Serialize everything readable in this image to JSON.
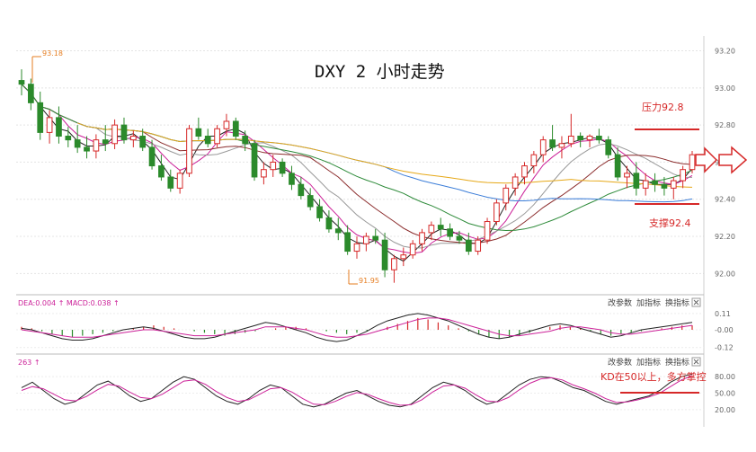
{
  "chart_data": [
    {
      "type": "candlestick",
      "title": "DXY 2 小时走势",
      "y_axis_ticks": [
        "93.20",
        "93.00",
        "92.80",
        "92.60",
        "92.40",
        "92.20",
        "92.00"
      ],
      "ylim": [
        91.9,
        93.28
      ],
      "grid": true,
      "extremes": {
        "high": "93.18",
        "low": "91.95"
      },
      "annotations": {
        "resistance_label": "压力92.8",
        "resistance_level": 92.8,
        "support_label": "支撑92.4",
        "support_level": 92.4,
        "kd_note": "KD在50以上，多方掌控"
      },
      "series": [
        {
          "values": [
            [
              93.04,
              93.1,
              92.96,
              93.02
            ],
            [
              93.02,
              93.05,
              92.88,
              92.92
            ],
            [
              92.92,
              92.98,
              92.72,
              92.76
            ],
            [
              92.76,
              92.88,
              92.7,
              92.84
            ],
            [
              92.84,
              92.9,
              92.7,
              92.74
            ],
            [
              92.74,
              92.79,
              92.68,
              92.72
            ],
            [
              92.72,
              92.8,
              92.65,
              92.68
            ],
            [
              92.68,
              92.74,
              92.62,
              92.66
            ],
            [
              92.66,
              92.75,
              92.62,
              92.72
            ],
            [
              92.72,
              92.8,
              92.66,
              92.7
            ],
            [
              92.7,
              92.83,
              92.67,
              92.8
            ],
            [
              92.8,
              92.84,
              92.7,
              92.72
            ],
            [
              92.72,
              92.77,
              92.68,
              92.74
            ],
            [
              92.74,
              92.78,
              92.66,
              92.68
            ],
            [
              92.68,
              92.72,
              92.56,
              92.58
            ],
            [
              92.58,
              92.64,
              92.5,
              92.52
            ],
            [
              92.52,
              92.56,
              92.44,
              92.46
            ],
            [
              92.46,
              92.56,
              92.43,
              92.54
            ],
            [
              92.54,
              92.8,
              92.52,
              92.78
            ],
            [
              92.78,
              92.84,
              92.72,
              92.74
            ],
            [
              92.74,
              92.78,
              92.68,
              92.7
            ],
            [
              92.7,
              92.8,
              92.68,
              92.78
            ],
            [
              92.78,
              92.86,
              92.74,
              92.82
            ],
            [
              92.82,
              92.84,
              92.72,
              92.74
            ],
            [
              92.74,
              92.77,
              92.66,
              92.7
            ],
            [
              92.7,
              92.72,
              92.5,
              92.52
            ],
            [
              92.52,
              92.6,
              92.48,
              92.56
            ],
            [
              92.56,
              92.64,
              92.52,
              92.6
            ],
            [
              92.6,
              92.62,
              92.52,
              92.54
            ],
            [
              92.54,
              92.58,
              92.45,
              92.48
            ],
            [
              92.48,
              92.52,
              92.4,
              92.42
            ],
            [
              92.42,
              92.46,
              92.34,
              92.36
            ],
            [
              92.36,
              92.4,
              92.28,
              92.3
            ],
            [
              92.3,
              92.34,
              92.22,
              92.24
            ],
            [
              92.24,
              92.3,
              92.18,
              92.22
            ],
            [
              92.22,
              92.26,
              92.1,
              92.12
            ],
            [
              92.12,
              92.2,
              92.08,
              92.16
            ],
            [
              92.16,
              92.22,
              92.12,
              92.2
            ],
            [
              92.2,
              92.24,
              92.16,
              92.18
            ],
            [
              92.18,
              92.22,
              91.98,
              92.02
            ],
            [
              92.02,
              92.1,
              91.95,
              92.08
            ],
            [
              92.08,
              92.14,
              92.04,
              92.1
            ],
            [
              92.1,
              92.18,
              92.08,
              92.16
            ],
            [
              92.16,
              92.24,
              92.12,
              92.22
            ],
            [
              92.22,
              92.28,
              92.18,
              92.26
            ],
            [
              92.26,
              92.3,
              92.2,
              92.24
            ],
            [
              92.24,
              92.27,
              92.18,
              92.2
            ],
            [
              92.2,
              92.23,
              92.16,
              92.18
            ],
            [
              92.18,
              92.22,
              92.1,
              92.12
            ],
            [
              92.12,
              92.2,
              92.1,
              92.18
            ],
            [
              92.18,
              92.3,
              92.16,
              92.28
            ],
            [
              92.28,
              92.4,
              92.26,
              92.38
            ],
            [
              92.38,
              92.48,
              92.34,
              92.46
            ],
            [
              92.46,
              92.54,
              92.42,
              92.52
            ],
            [
              92.52,
              92.6,
              92.48,
              92.58
            ],
            [
              92.58,
              92.66,
              92.54,
              92.64
            ],
            [
              92.64,
              92.74,
              92.6,
              92.72
            ],
            [
              92.72,
              92.8,
              92.66,
              92.68
            ],
            [
              92.68,
              92.74,
              92.62,
              92.7
            ],
            [
              92.7,
              92.86,
              92.68,
              92.74
            ],
            [
              92.74,
              92.76,
              92.68,
              92.72
            ],
            [
              92.72,
              92.75,
              92.68,
              92.74
            ],
            [
              92.74,
              92.78,
              92.7,
              92.72
            ],
            [
              92.72,
              92.74,
              92.62,
              92.64
            ],
            [
              92.64,
              92.68,
              92.5,
              92.52
            ],
            [
              92.52,
              92.58,
              92.46,
              92.54
            ],
            [
              92.54,
              92.6,
              92.42,
              92.46
            ],
            [
              92.46,
              92.54,
              92.42,
              92.5
            ],
            [
              92.5,
              92.54,
              92.44,
              92.48
            ],
            [
              92.48,
              92.52,
              92.42,
              92.46
            ],
            [
              92.46,
              92.52,
              92.4,
              92.5
            ],
            [
              92.5,
              92.58,
              92.46,
              92.56
            ],
            [
              92.56,
              92.66,
              92.54,
              92.64
            ]
          ]
        }
      ]
    },
    {
      "type": "line",
      "indicator_label": "DEA:0.004 ↑ MACD:0.038 ↑",
      "y_axis_ticks": [
        "0.11",
        "-0.00",
        "-0.12"
      ],
      "ylim": [
        -0.14,
        0.14
      ],
      "controls": [
        "改参数",
        "加指标",
        "换指标"
      ],
      "histogram": [
        0.02,
        0.01,
        -0.01,
        -0.03,
        -0.04,
        -0.05,
        -0.04,
        -0.03,
        -0.02,
        -0.01,
        0.0,
        0.01,
        0.02,
        0.03,
        0.02,
        0.01,
        0.0,
        -0.01,
        -0.02,
        -0.03,
        -0.04,
        -0.03,
        -0.02,
        -0.01,
        0.0,
        0.01,
        0.02,
        0.02,
        0.01,
        0.0,
        -0.01,
        -0.02,
        -0.03,
        -0.02,
        -0.01,
        0.0,
        0.02,
        0.04,
        0.06,
        0.08,
        0.07,
        0.05,
        0.03,
        0.01,
        -0.01,
        -0.03,
        -0.05,
        -0.06,
        -0.05,
        -0.04,
        -0.02,
        0.0,
        0.02,
        0.03,
        0.02,
        0.01,
        -0.01,
        -0.03,
        -0.04,
        -0.03,
        -0.02,
        -0.01,
        0.0,
        0.01,
        0.02,
        0.03,
        0.03
      ],
      "series": [
        {
          "values": [
            0.01,
            0.0,
            -0.02,
            -0.04,
            -0.06,
            -0.07,
            -0.07,
            -0.06,
            -0.04,
            -0.02,
            0.0,
            0.01,
            0.02,
            0.01,
            -0.01,
            -0.03,
            -0.05,
            -0.06,
            -0.06,
            -0.05,
            -0.03,
            -0.01,
            0.01,
            0.03,
            0.05,
            0.04,
            0.02,
            0.0,
            -0.02,
            -0.05,
            -0.07,
            -0.08,
            -0.07,
            -0.04,
            -0.01,
            0.03,
            0.06,
            0.08,
            0.1,
            0.11,
            0.1,
            0.08,
            0.06,
            0.03,
            0.0,
            -0.03,
            -0.05,
            -0.06,
            -0.05,
            -0.03,
            -0.01,
            0.01,
            0.03,
            0.04,
            0.03,
            0.01,
            -0.01,
            -0.03,
            -0.05,
            -0.04,
            -0.02,
            0.0,
            0.01,
            0.02,
            0.03,
            0.04,
            0.05
          ]
        },
        {
          "values": [
            0.0,
            -0.01,
            -0.02,
            -0.03,
            -0.04,
            -0.05,
            -0.05,
            -0.05,
            -0.04,
            -0.03,
            -0.02,
            -0.01,
            0.0,
            0.0,
            -0.01,
            -0.02,
            -0.03,
            -0.04,
            -0.04,
            -0.04,
            -0.03,
            -0.02,
            -0.01,
            0.0,
            0.02,
            0.02,
            0.02,
            0.01,
            0.0,
            -0.02,
            -0.04,
            -0.05,
            -0.05,
            -0.04,
            -0.03,
            -0.01,
            0.01,
            0.03,
            0.05,
            0.07,
            0.08,
            0.08,
            0.07,
            0.05,
            0.03,
            0.01,
            -0.01,
            -0.03,
            -0.04,
            -0.04,
            -0.03,
            -0.02,
            -0.01,
            0.01,
            0.02,
            0.02,
            0.01,
            0.0,
            -0.02,
            -0.03,
            -0.03,
            -0.02,
            -0.01,
            0.0,
            0.01,
            0.02,
            0.03
          ]
        }
      ]
    },
    {
      "type": "line",
      "indicator_label": "263 ↑",
      "y_axis_ticks": [
        "80.00",
        "50.00",
        "20.00"
      ],
      "ylim": [
        10,
        95
      ],
      "controls": [
        "改参数",
        "加指标",
        "换指标"
      ],
      "series": [
        {
          "values": [
            60,
            70,
            55,
            40,
            30,
            35,
            50,
            65,
            72,
            60,
            45,
            35,
            40,
            55,
            70,
            80,
            75,
            60,
            45,
            35,
            30,
            40,
            55,
            65,
            60,
            45,
            30,
            25,
            30,
            40,
            50,
            55,
            45,
            35,
            28,
            25,
            30,
            45,
            60,
            70,
            65,
            55,
            40,
            30,
            35,
            50,
            65,
            75,
            80,
            78,
            70,
            60,
            55,
            45,
            35,
            30,
            35,
            40,
            45,
            55,
            70,
            80,
            85
          ]
        },
        {
          "values": [
            55,
            62,
            58,
            48,
            38,
            36,
            44,
            56,
            66,
            63,
            52,
            42,
            40,
            48,
            60,
            72,
            74,
            66,
            53,
            42,
            35,
            38,
            48,
            58,
            60,
            52,
            40,
            30,
            29,
            35,
            44,
            51,
            48,
            40,
            33,
            28,
            29,
            38,
            52,
            63,
            65,
            59,
            47,
            36,
            34,
            42,
            56,
            68,
            76,
            78,
            74,
            65,
            58,
            50,
            40,
            33,
            34,
            38,
            43,
            50,
            62,
            74,
            82
          ]
        }
      ]
    }
  ]
}
